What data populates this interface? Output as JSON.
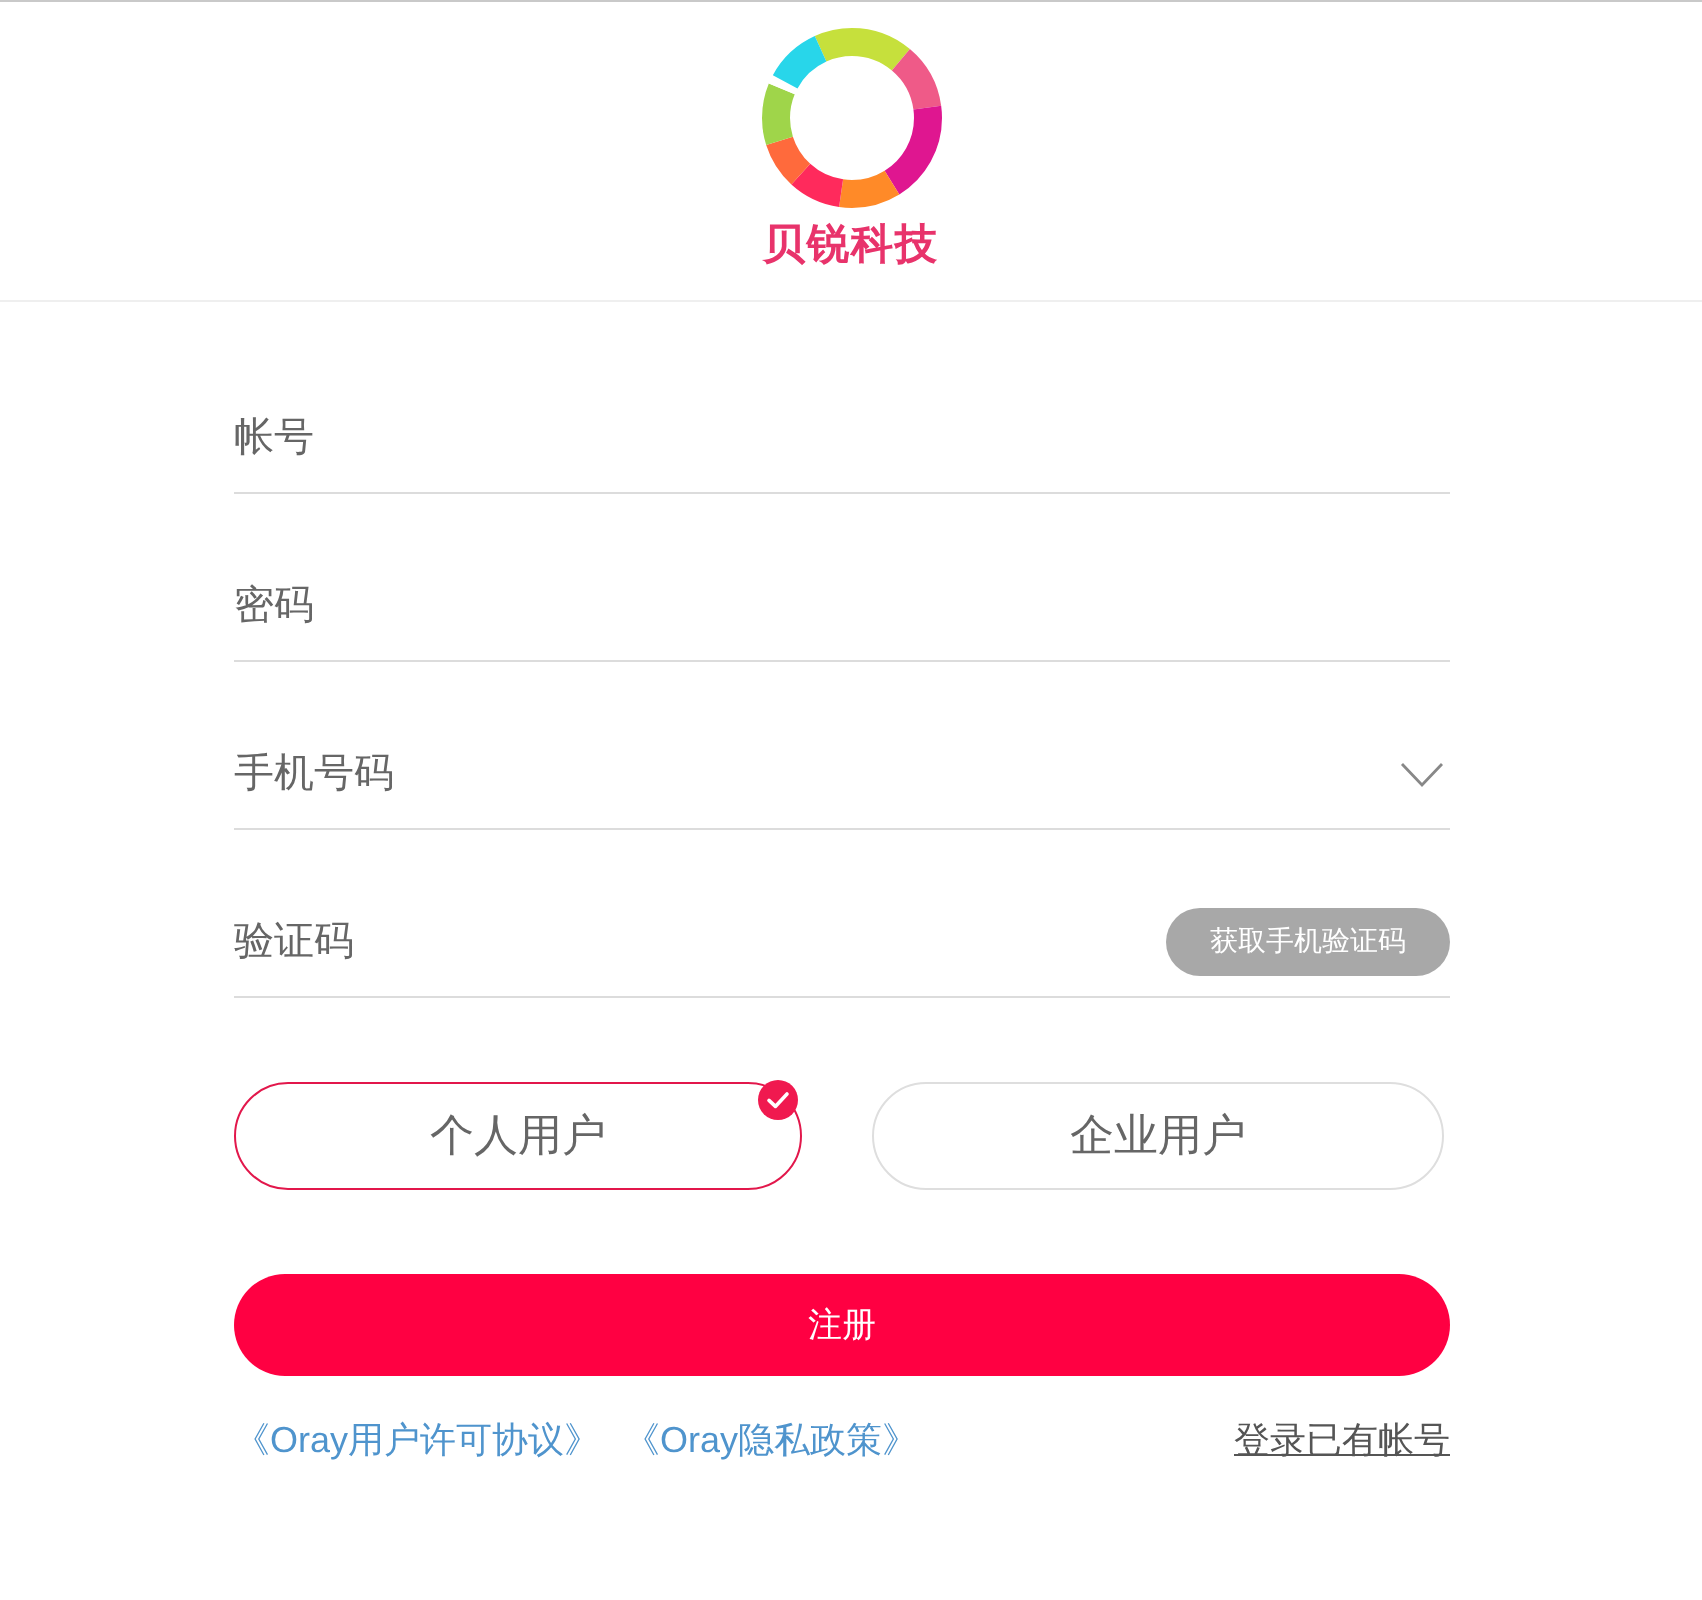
{
  "header": {
    "brand": "贝锐科技"
  },
  "fields": [
    {
      "kind": "account",
      "placeholder": "帐号"
    },
    {
      "kind": "password",
      "placeholder": "密码"
    },
    {
      "kind": "phone",
      "placeholder": "手机号码"
    },
    {
      "kind": "code",
      "placeholder": "验证码",
      "button": "获取手机验证码",
      "disabled": true
    }
  ],
  "user_types": [
    {
      "label": "个人用户",
      "selected": true
    },
    {
      "label": "企业用户",
      "selected": false
    }
  ],
  "submit": {
    "label": "注册"
  },
  "links": [
    {
      "label": "《Oray用户许可协议》"
    },
    {
      "label": "《Oray隐私政策》"
    }
  ],
  "login_link": {
    "label": "登录已有帐号"
  }
}
